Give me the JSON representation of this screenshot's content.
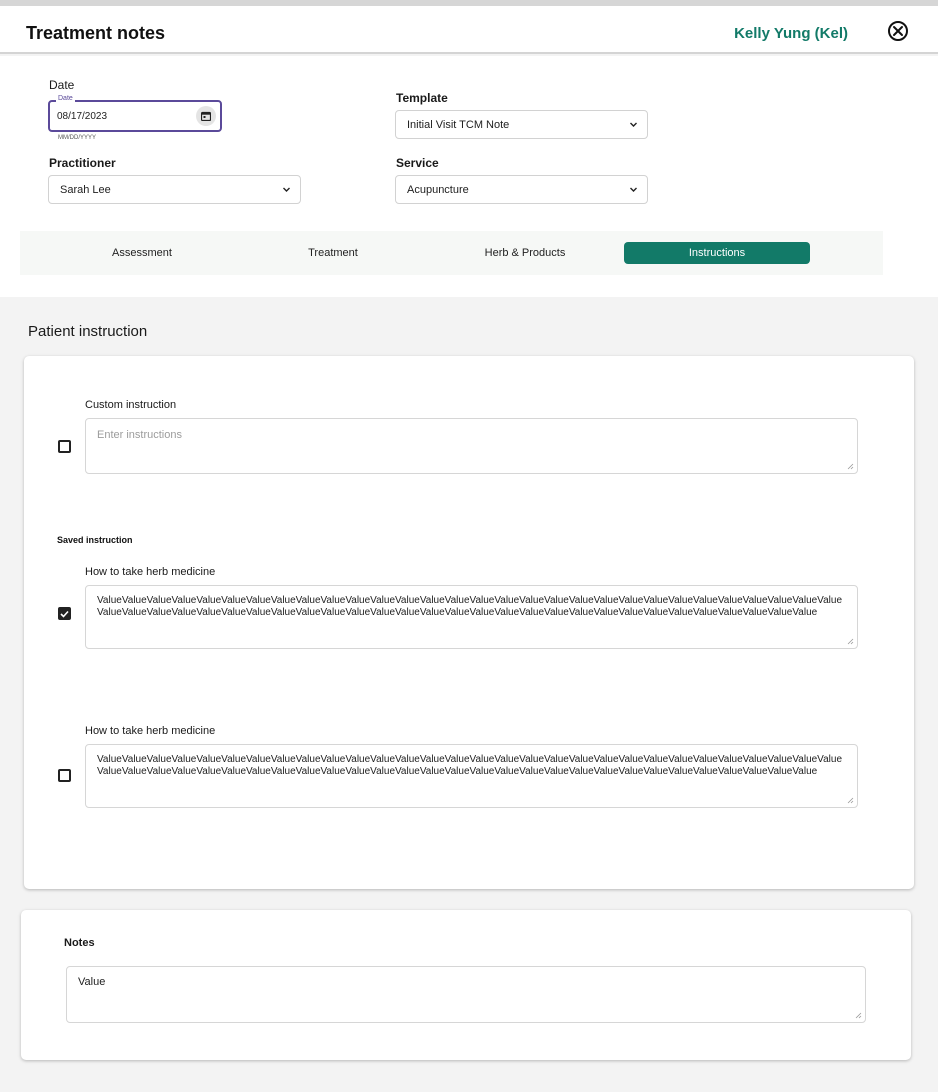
{
  "header": {
    "title": "Treatment notes",
    "patient_name": "Kelly Yung (Kel)"
  },
  "form": {
    "date": {
      "label": "Date",
      "mini_label": "Date",
      "value": "08/17/2023",
      "hint": "MM/DD/YYYY"
    },
    "template": {
      "label": "Template",
      "value": "Initial Visit TCM Note"
    },
    "practitioner": {
      "label": "Practitioner",
      "value": "Sarah Lee"
    },
    "service": {
      "label": "Service",
      "value": "Acupuncture"
    }
  },
  "tabs": [
    {
      "label": "Assessment",
      "active": false
    },
    {
      "label": "Treatment",
      "active": false
    },
    {
      "label": "Herb & Products",
      "active": false
    },
    {
      "label": "Instructions",
      "active": true
    }
  ],
  "instructions": {
    "section_title": "Patient instruction",
    "custom": {
      "label": "Custom instruction",
      "placeholder": "Enter instructions",
      "checked": false
    },
    "saved_heading": "Saved instruction",
    "saved": [
      {
        "label": "How to take herb medicine",
        "checked": true,
        "value": "ValueValueValueValueValueValueValueValueValueValueValueValueValueValueValueValueValueValueValueValueValueValueValueValueValueValueValueValueValueValueValueValueValueValueValueValueValueValueValueValueValueValueValueValueValueValueValueValueValueValueValueValueValueValueValueValueValueValueValue"
      },
      {
        "label": "How to take herb medicine",
        "checked": false,
        "value": "ValueValueValueValueValueValueValueValueValueValueValueValueValueValueValueValueValueValueValueValueValueValueValueValueValueValueValueValueValueValueValueValueValueValueValueValueValueValueValueValueValueValueValueValueValueValueValueValueValueValueValueValueValueValueValueValueValueValueValue"
      }
    ]
  },
  "notes": {
    "label": "Notes",
    "value": "Value"
  },
  "colors": {
    "accent": "#127a68",
    "focus": "#5b4a9a",
    "background": "#f3f3f3"
  },
  "icons": [
    "close-circle-icon",
    "calendar-icon",
    "chevron-down-icon",
    "checkmark-icon",
    "resize-grip-icon"
  ]
}
